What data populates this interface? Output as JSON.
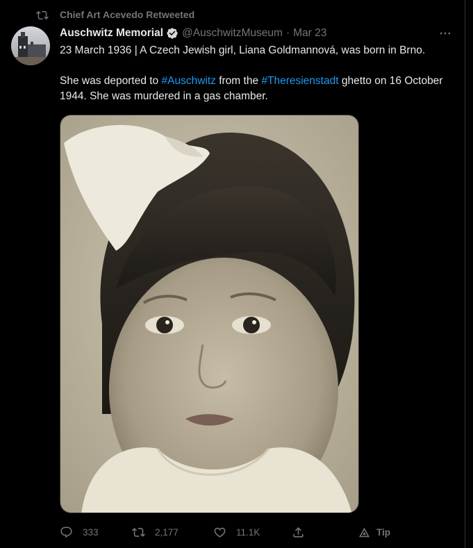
{
  "retweet": {
    "text": "Chief Art Acevedo Retweeted",
    "icon": "retweet-icon"
  },
  "author": {
    "name": "Auschwitz Memorial",
    "handle": "@AuschwitzMuseum",
    "separator": "·",
    "date": "Mar 23",
    "verified": true
  },
  "tweet": {
    "line1": "23 March 1936 | A Czech Jewish girl, Liana Goldmannová, was born in Brno.",
    "p2_a": "She was deported to ",
    "p2_hashtag1": "#Auschwitz",
    "p2_b": " from the ",
    "p2_hashtag2": "#Theresienstadt",
    "p2_c": " ghetto on 16 October 1944. She was murdered in a gas chamber."
  },
  "actions": {
    "reply": {
      "icon": "reply-icon",
      "count": "333"
    },
    "retweet": {
      "icon": "retweet-icon",
      "count": "2,177"
    },
    "like": {
      "icon": "heart-icon",
      "count": "11.1K"
    },
    "share": {
      "icon": "share-icon"
    },
    "tip": {
      "icon": "tip-icon",
      "label": "Tip"
    }
  },
  "colors": {
    "background": "#000000",
    "text": "#e7e9ea",
    "secondary": "#71767b",
    "link": "#1d9bf0",
    "verified_badge": "#d6d9db"
  }
}
